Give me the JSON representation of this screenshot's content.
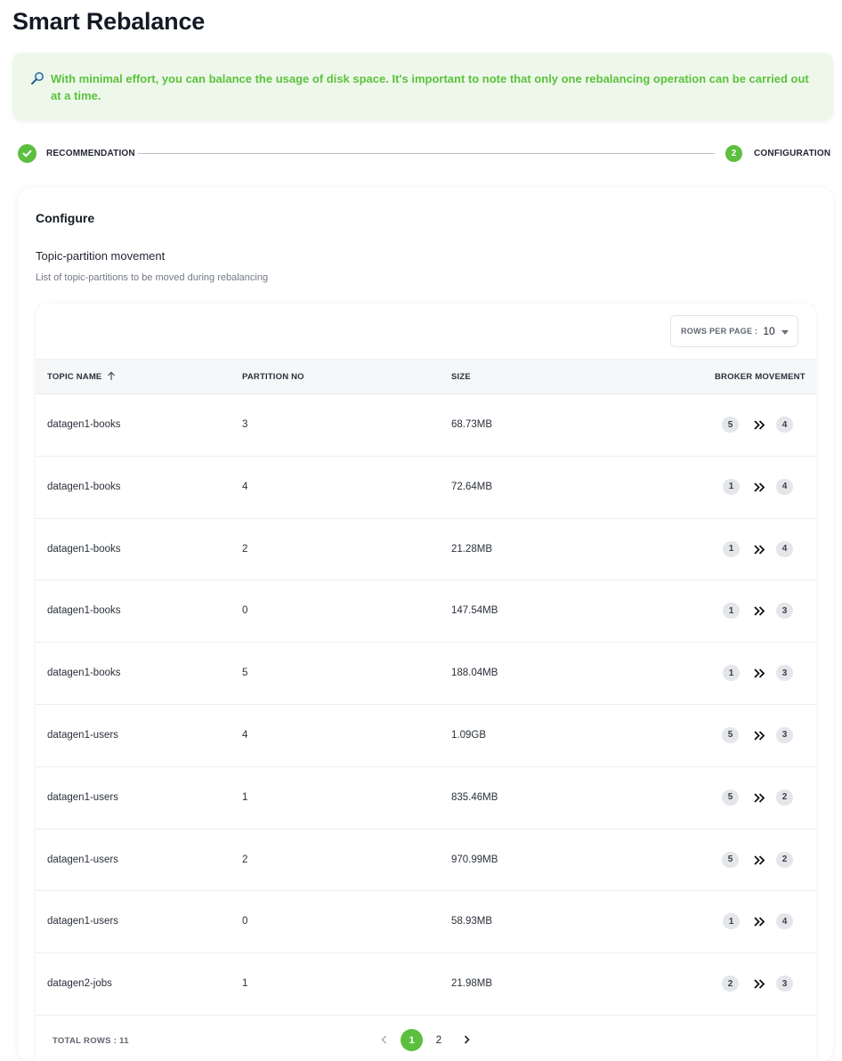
{
  "page": {
    "title": "Smart Rebalance"
  },
  "banner": {
    "icon": "magnifier-icon",
    "text": "With minimal effort, you can balance the usage of disk space. It's important to note that only one rebalancing operation can be carried out at a time.",
    "color": "#5cc23e",
    "background": "#eef8ea"
  },
  "stepper": {
    "steps": [
      {
        "label": "RECOMMENDATION",
        "state": "done",
        "icon": "check-icon"
      },
      {
        "label": "CONFIGURATION",
        "state": "active",
        "number": "2"
      }
    ],
    "accent": "#5cbf3f"
  },
  "configure": {
    "title": "Configure",
    "section_title": "Topic-partition movement",
    "section_subtitle": "List of topic-partitions to be moved during rebalancing"
  },
  "table": {
    "rows_per_page_label": "ROWS PER PAGE :",
    "rows_per_page_value": "10",
    "columns": [
      "TOPIC NAME",
      "PARTITION NO",
      "SIZE",
      "BROKER MOVEMENT"
    ],
    "sort": {
      "column": "TOPIC NAME",
      "direction": "ascending",
      "icon": "arrow-up-icon"
    },
    "rows": [
      {
        "topic": "datagen1-books",
        "partition": "3",
        "size": "68.73MB",
        "from": "5",
        "to": "4"
      },
      {
        "topic": "datagen1-books",
        "partition": "4",
        "size": "72.64MB",
        "from": "1",
        "to": "4"
      },
      {
        "topic": "datagen1-books",
        "partition": "2",
        "size": "21.28MB",
        "from": "1",
        "to": "4"
      },
      {
        "topic": "datagen1-books",
        "partition": "0",
        "size": "147.54MB",
        "from": "1",
        "to": "3"
      },
      {
        "topic": "datagen1-books",
        "partition": "5",
        "size": "188.04MB",
        "from": "1",
        "to": "3"
      },
      {
        "topic": "datagen1-users",
        "partition": "4",
        "size": "1.09GB",
        "from": "5",
        "to": "3"
      },
      {
        "topic": "datagen1-users",
        "partition": "1",
        "size": "835.46MB",
        "from": "5",
        "to": "2"
      },
      {
        "topic": "datagen1-users",
        "partition": "2",
        "size": "970.99MB",
        "from": "5",
        "to": "2"
      },
      {
        "topic": "datagen1-users",
        "partition": "0",
        "size": "58.93MB",
        "from": "1",
        "to": "4"
      },
      {
        "topic": "datagen2-jobs",
        "partition": "1",
        "size": "21.98MB",
        "from": "2",
        "to": "3"
      }
    ],
    "total_rows_label": "TOTAL ROWS : 11",
    "pagination": {
      "pages": [
        "1",
        "2"
      ],
      "current": "1",
      "prev_icon": "chevron-left-icon",
      "next_icon": "chevron-right-icon"
    }
  }
}
